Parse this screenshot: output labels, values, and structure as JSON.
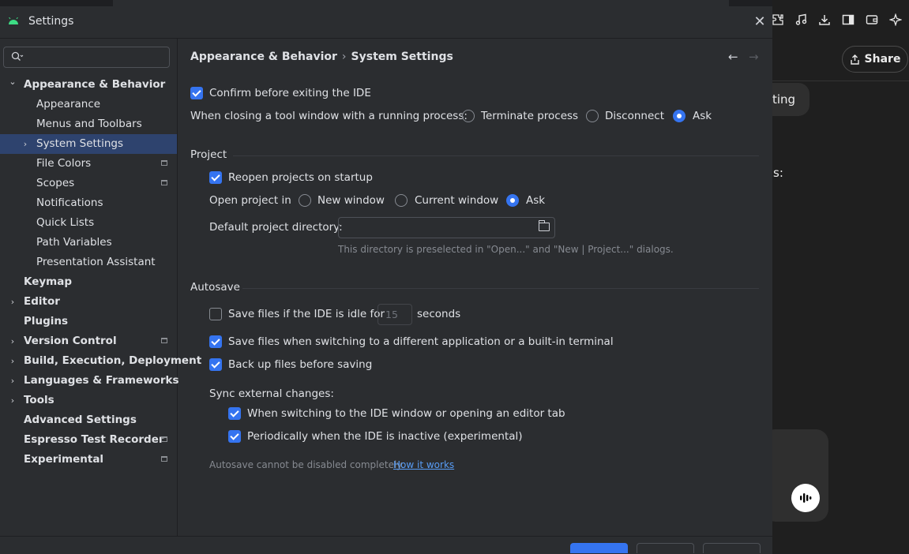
{
  "background_app": {
    "share_label": "Share",
    "pill_text": "ting",
    "fragment_text": "s:",
    "toolbar_icons": [
      "extension-icon",
      "music-note-icon",
      "download-icon",
      "sidebar-icon",
      "wallet-icon",
      "sparkle-icon"
    ]
  },
  "dialog": {
    "title": "Settings",
    "search": {
      "placeholder": "",
      "value": ""
    },
    "tree": [
      {
        "label": "Appearance & Behavior",
        "level": 0,
        "expanded": true,
        "bold": true
      },
      {
        "label": "Appearance",
        "level": 1
      },
      {
        "label": "Menus and Toolbars",
        "level": 1
      },
      {
        "label": "System Settings",
        "level": 1,
        "selected": true,
        "collapsed": true
      },
      {
        "label": "File Colors",
        "level": 1,
        "modified": true
      },
      {
        "label": "Scopes",
        "level": 1,
        "modified": true
      },
      {
        "label": "Notifications",
        "level": 1
      },
      {
        "label": "Quick Lists",
        "level": 1
      },
      {
        "label": "Path Variables",
        "level": 1
      },
      {
        "label": "Presentation Assistant",
        "level": 1
      },
      {
        "label": "Keymap",
        "level": 0,
        "bold": true
      },
      {
        "label": "Editor",
        "level": 0,
        "collapsed": true,
        "bold": true
      },
      {
        "label": "Plugins",
        "level": 0,
        "bold": true
      },
      {
        "label": "Version Control",
        "level": 0,
        "collapsed": true,
        "bold": true,
        "modified": true
      },
      {
        "label": "Build, Execution, Deployment",
        "level": 0,
        "collapsed": true,
        "bold": true
      },
      {
        "label": "Languages & Frameworks",
        "level": 0,
        "collapsed": true,
        "bold": true
      },
      {
        "label": "Tools",
        "level": 0,
        "collapsed": true,
        "bold": true
      },
      {
        "label": "Advanced Settings",
        "level": 0,
        "bold": true
      },
      {
        "label": "Espresso Test Recorder",
        "level": 0,
        "bold": true,
        "modified": true
      },
      {
        "label": "Experimental",
        "level": 0,
        "bold": true,
        "modified": true
      }
    ],
    "breadcrumb": {
      "parent": "Appearance & Behavior",
      "separator": "›",
      "current": "System Settings"
    },
    "general": {
      "confirm_exit": {
        "label": "Confirm before exiting the IDE",
        "checked": true
      },
      "tool_window_label": "When closing a tool window with a running process:",
      "tool_window_options": [
        {
          "label": "Terminate process",
          "selected": false
        },
        {
          "label": "Disconnect",
          "selected": false
        },
        {
          "label": "Ask",
          "selected": true
        }
      ]
    },
    "project": {
      "title": "Project",
      "reopen": {
        "label": "Reopen projects on startup",
        "checked": true
      },
      "open_in_label": "Open project in",
      "open_in_options": [
        {
          "label": "New window",
          "selected": false
        },
        {
          "label": "Current window",
          "selected": false
        },
        {
          "label": "Ask",
          "selected": true
        }
      ],
      "default_dir_label": "Default project directory:",
      "default_dir_value": "",
      "default_dir_hint": "This directory is preselected in \"Open...\" and \"New | Project...\" dialogs."
    },
    "autosave": {
      "title": "Autosave",
      "idle": {
        "label_before": "Save files if the IDE is idle for",
        "value": "15",
        "label_after": "seconds",
        "checked": false
      },
      "switching": {
        "label": "Save files when switching to a different application or a built-in terminal",
        "checked": true
      },
      "backup": {
        "label": "Back up files before saving",
        "checked": true
      },
      "sync_label": "Sync external changes:",
      "sync_switch": {
        "label": "When switching to the IDE window or opening an editor tab",
        "checked": true
      },
      "sync_periodic": {
        "label": "Periodically when the IDE is inactive (experimental)",
        "checked": true
      },
      "note": "Autosave cannot be disabled completely.",
      "note_link": "How it works"
    }
  }
}
